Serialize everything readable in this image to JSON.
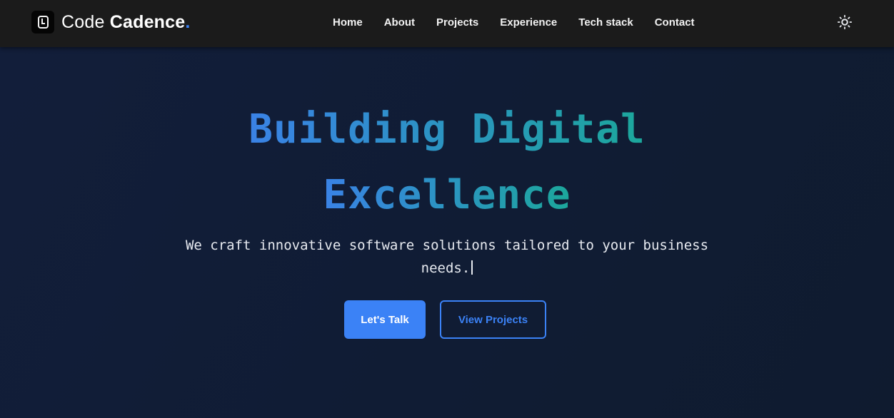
{
  "brand": {
    "prefix": "Code",
    "name": "Cadence",
    "dot": ".",
    "accent": "#3b82f6"
  },
  "nav": {
    "items": [
      {
        "label": "Home"
      },
      {
        "label": "About"
      },
      {
        "label": "Projects"
      },
      {
        "label": "Experience"
      },
      {
        "label": "Tech stack"
      },
      {
        "label": "Contact"
      }
    ],
    "theme_toggle_icon": "sun-icon"
  },
  "hero": {
    "headline_line1": "Building Digital",
    "headline_line2": "Excellence",
    "gradient_start": "#3a82e6",
    "gradient_end": "#1ca79b",
    "subtitle_line1": "We craft innovative software solutions tailored to your business",
    "subtitle_line2": "needs.",
    "primary_button": "Let's Talk",
    "secondary_button": "View Projects"
  }
}
